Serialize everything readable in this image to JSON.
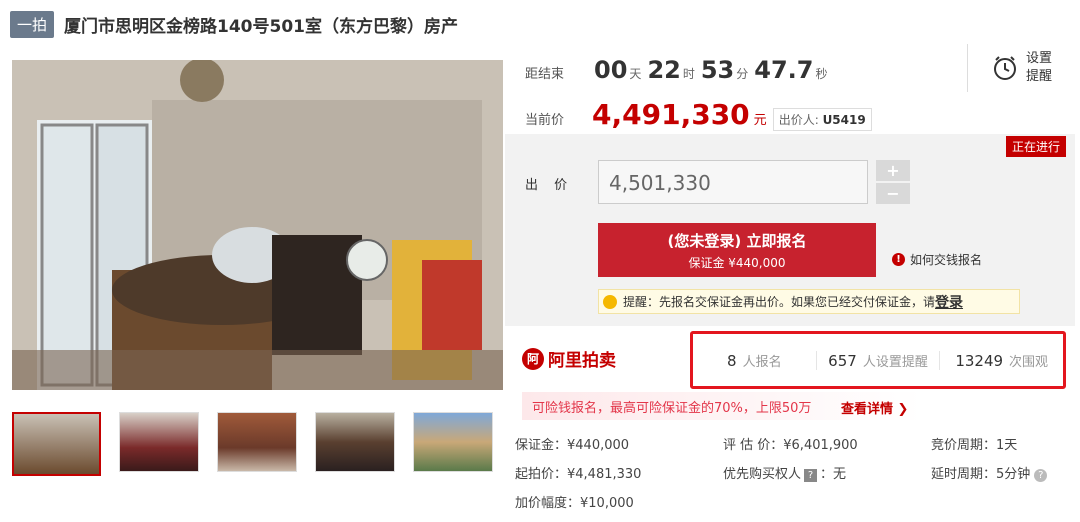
{
  "header": {
    "badge": "一拍",
    "title": "厦门市思明区金榜路140号501室（东方巴黎）房产"
  },
  "countdown": {
    "label": "距结束",
    "days": "00",
    "days_unit": "天",
    "hours": "22",
    "hours_unit": "时",
    "minutes": "53",
    "minutes_unit": "分",
    "seconds": "47.7",
    "seconds_unit": "秒"
  },
  "current": {
    "label": "当前价",
    "price": "4,491,330",
    "unit": "元",
    "bidder_label": "出价人:",
    "bidder": "U5419"
  },
  "reminder": {
    "label_line1": "设置",
    "label_line2": "提醒",
    "icon": "alarm-clock-icon"
  },
  "status": "正在进行",
  "bid": {
    "label": "出 价",
    "value": "4,501,330",
    "plus": "+",
    "minus": "−"
  },
  "signup": {
    "main": "(您未登录) 立即报名",
    "sub": "保证金 ¥440,000"
  },
  "howto": "如何交钱报名",
  "tip": {
    "text": "提醒：先报名交保证金再出价。如果您已经交付保证金，请",
    "link": "登录"
  },
  "platform": {
    "logo_text": "阿里拍卖"
  },
  "stats": [
    {
      "count": "8",
      "label": "人报名"
    },
    {
      "count": "657",
      "label": "人设置提醒"
    },
    {
      "count": "13249",
      "label": "次围观"
    }
  ],
  "loan": {
    "text": "可险钱报名，最高可险保证金的70%，上限50万",
    "link": "查看详情 ❯"
  },
  "details": {
    "deposit": "保证金：¥440,000",
    "start_price": "起拍价：¥4,481,330",
    "increment": "加价幅度：¥10,000",
    "appraisal": "评 估 价：¥6,401,900",
    "priority_label": "优先购买权人",
    "priority_badge": "?",
    "priority_value": "：无",
    "cycle": "竞价周期：1天",
    "delay": "延时周期：5分钟"
  },
  "colors": {
    "accent": "#c40000",
    "button": "#c7222e",
    "highlight_border": "#e3161e"
  }
}
